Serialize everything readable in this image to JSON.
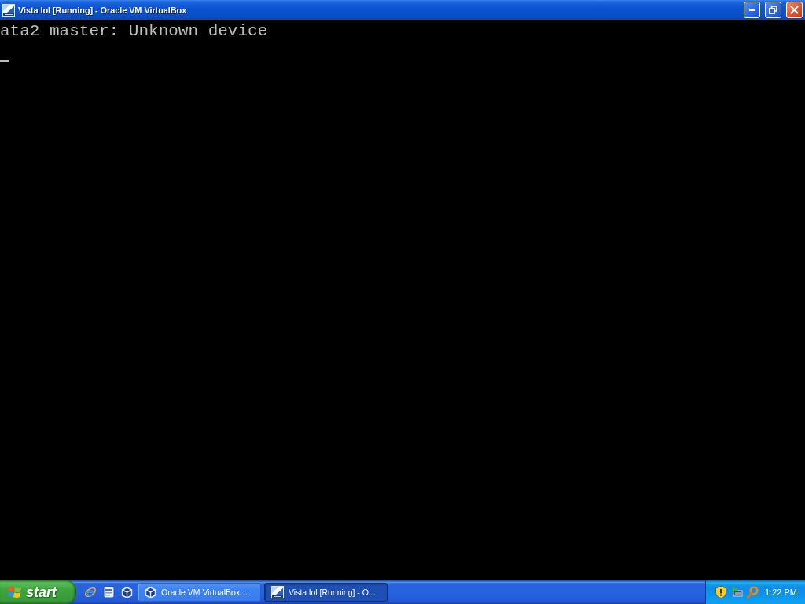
{
  "window": {
    "title": "Vista lol [Running] - Oracle VM VirtualBox"
  },
  "console": {
    "lines": [
      "ata2 master: Unknown device"
    ]
  },
  "taskbar": {
    "start_label": "start",
    "tasks": [
      {
        "kind": "manager",
        "label": "Oracle VM VirtualBox ...",
        "selected": false
      },
      {
        "kind": "vm",
        "label": "Vista lol [Running] - O...",
        "selected": true
      }
    ],
    "clock": "1:22 PM"
  }
}
